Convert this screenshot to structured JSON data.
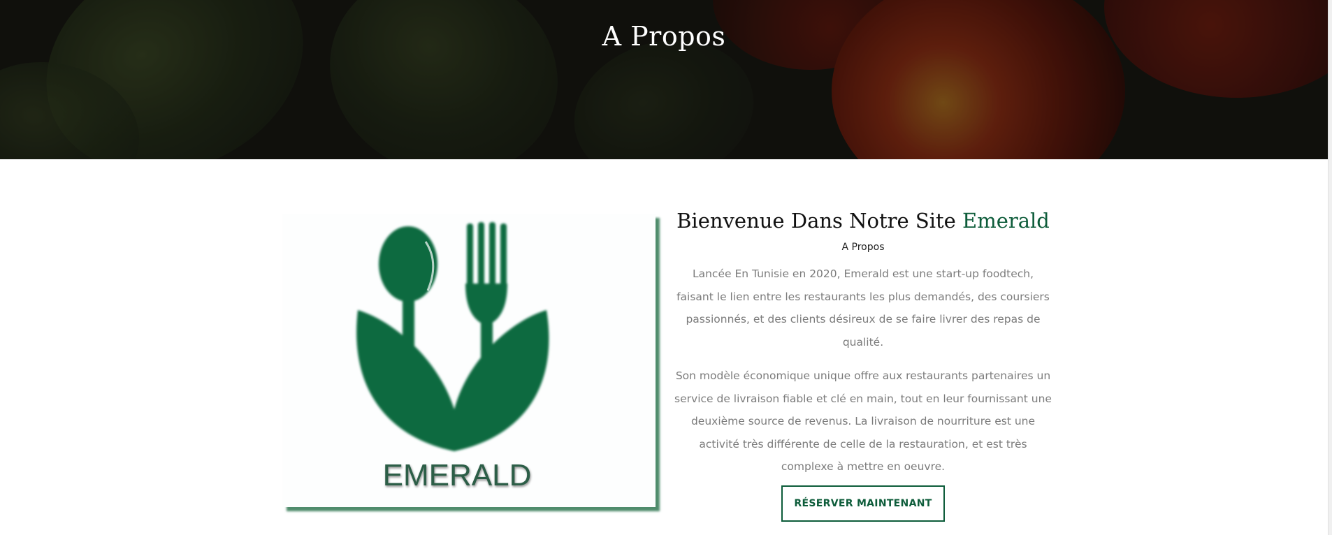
{
  "hero": {
    "title": "A Propos"
  },
  "logo": {
    "text": "EMERALD",
    "color": "#0b6a41",
    "shadow_color": "#4f8c6c"
  },
  "about": {
    "heading_prefix": "Bienvenue Dans Notre Site ",
    "heading_brand": "Emerald",
    "subheading": "A Propos",
    "paragraph_1": "Lancée En Tunisie en 2020, Emerald est une start-up foodtech, faisant le lien entre les restaurants les plus demandés, des coursiers passionnés, et des clients désireux de se faire livrer des repas de qualité.",
    "paragraph_2": "Son modèle économique unique offre aux restaurants partenaires un service de livraison fiable et clé en main, tout en leur fournissant une deuxième source de revenus. La livraison de nourriture est une activité très différente de celle de la restauration, et est très complexe à mettre en oeuvre.",
    "button_label": "RÉSERVER MAINTENANT"
  },
  "colors": {
    "accent": "#0d5c3a",
    "text_muted": "#7b7b7b"
  }
}
